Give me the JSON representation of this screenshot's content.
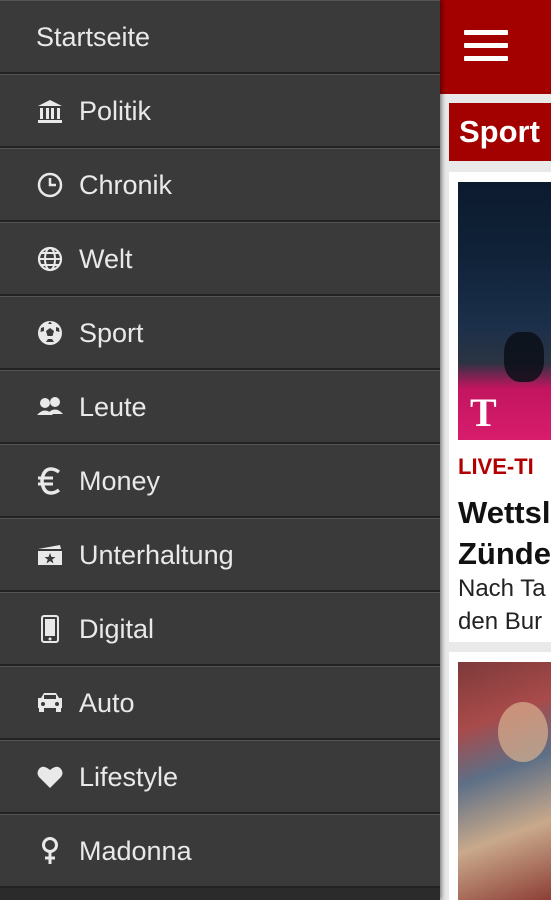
{
  "header": {
    "menu_icon": "hamburger-menu-icon",
    "brand_color": "#a30000"
  },
  "section": {
    "label": "Sport"
  },
  "articles": [
    {
      "kicker": "LIVE-TI",
      "headline_line1": "Wettsl",
      "headline_line2": "Zünde",
      "teaser_line1": "Nach Ta",
      "teaser_line2": "den Bur"
    }
  ],
  "drawer": {
    "background": "#3a3a3a",
    "items": [
      {
        "label": "Startseite",
        "icon": ""
      },
      {
        "label": "Politik",
        "icon": "building-icon"
      },
      {
        "label": "Chronik",
        "icon": "clock-icon"
      },
      {
        "label": "Welt",
        "icon": "globe-icon"
      },
      {
        "label": "Sport",
        "icon": "soccer-ball-icon"
      },
      {
        "label": "Leute",
        "icon": "people-icon"
      },
      {
        "label": "Money",
        "icon": "euro-icon"
      },
      {
        "label": "Unterhaltung",
        "icon": "ticket-star-icon"
      },
      {
        "label": "Digital",
        "icon": "smartphone-icon"
      },
      {
        "label": "Auto",
        "icon": "car-icon"
      },
      {
        "label": "Lifestyle",
        "icon": "heart-icon"
      },
      {
        "label": "Madonna",
        "icon": "female-symbol-icon"
      }
    ]
  }
}
